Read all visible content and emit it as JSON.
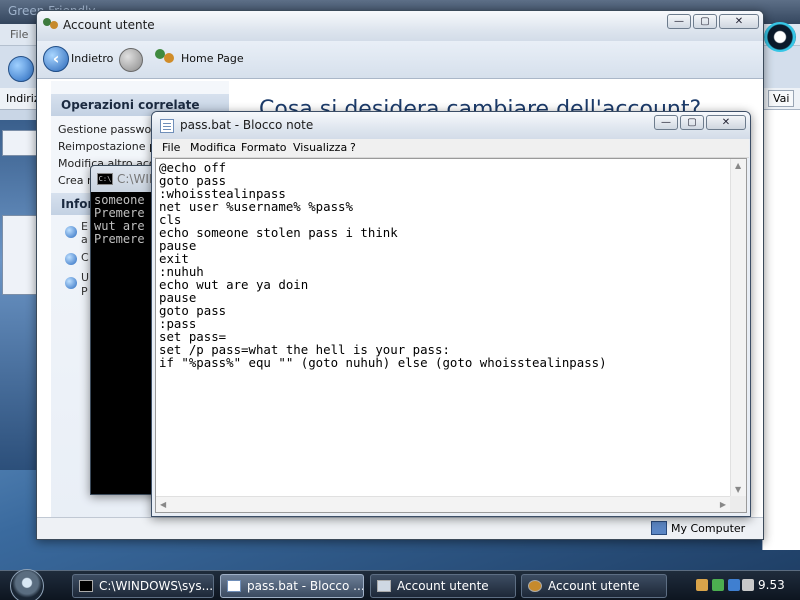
{
  "background_browser": {
    "tab_text": "Green Friendly",
    "menu_file": "File",
    "address_label": "Indiriz",
    "go_button": "Vai"
  },
  "account_window": {
    "title": "Account utente",
    "controls": {
      "minimize": "—",
      "maximize": "▢",
      "close": "✕"
    },
    "nav": {
      "back_label": "Indietro",
      "home_label": "Home Page"
    },
    "sidebar": {
      "related_heading": "Operazioni correlate",
      "related_items": [
        "Gestione password",
        "Reimpostazione pas",
        "Modifica altro accou",
        "Crea r"
      ],
      "info_heading": "Infor",
      "info_items": [
        "E",
        "a",
        "C",
        "U",
        "P"
      ]
    },
    "heading": "Cosa si desidera cambiare dell'account?",
    "status": "My Computer"
  },
  "cmd_window": {
    "title": "C:\\WINDOWS",
    "icon_text": "C:\\",
    "lines": [
      "someone",
      "Premere",
      "wut are",
      "Premere"
    ]
  },
  "notepad_window": {
    "title": "pass.bat - Blocco note",
    "menu": [
      "File",
      "Modifica",
      "Formato",
      "Visualizza",
      "?"
    ],
    "code_lines": [
      "@echo off",
      "goto pass",
      ":whoisstealinpass",
      "net user %username% %pass%",
      "cls",
      "echo someone stolen pass i think",
      "pause",
      "exit",
      ":nuhuh",
      "echo wut are ya doin",
      "pause",
      "goto pass",
      ":pass",
      "set pass=",
      "set /p pass=what the hell is your pass:",
      "if \"%pass%\" equ \"\" (goto nuhuh) else (goto whoisstealinpass)"
    ]
  },
  "taskbar": {
    "tasks": [
      {
        "label": "C:\\WINDOWS\\sys...",
        "active": false
      },
      {
        "label": "pass.bat - Blocco ...",
        "active": true
      },
      {
        "label": "Account utente",
        "active": false
      },
      {
        "label": "Account utente",
        "active": false
      }
    ],
    "clock": "9.53"
  }
}
